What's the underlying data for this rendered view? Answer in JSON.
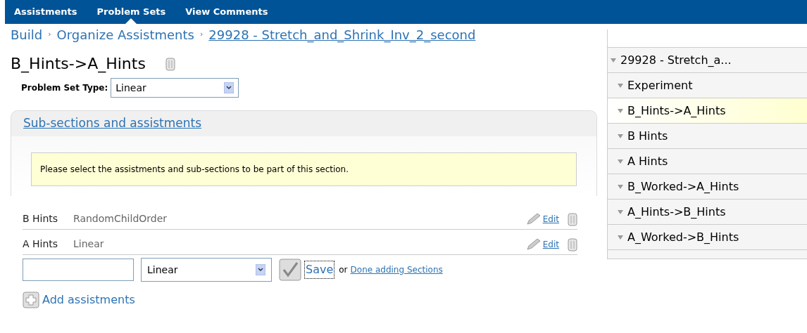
{
  "nav": {
    "tabs": [
      {
        "label": "Assistments",
        "selected": false
      },
      {
        "label": "Problem Sets",
        "selected": true
      },
      {
        "label": "View Comments",
        "selected": false
      }
    ]
  },
  "breadcrumb": {
    "items": [
      {
        "label": "Build",
        "kind": "text"
      },
      {
        "label": "Organize Assistments",
        "kind": "text"
      },
      {
        "label": "29928 - Stretch_and_Shrink_Inv_2_second",
        "kind": "link"
      }
    ],
    "separator": "›"
  },
  "title": "B_Hints->A_Hints",
  "problem_set_type": {
    "label": "Problem Set Type:",
    "value": "Linear"
  },
  "section": {
    "heading": "Sub-sections and assistments",
    "notice": "Please select the assistments and sub-sections to be part of this section.",
    "rows": [
      {
        "name": "B Hints",
        "order": "RandomChildOrder",
        "edit": "Edit"
      },
      {
        "name": "A Hints",
        "order": "Linear",
        "edit": "Edit"
      }
    ],
    "add_form": {
      "type_value": "Linear",
      "save": "Save",
      "or": "or",
      "done": "Done adding Sections"
    },
    "add_link": "Add assistments"
  },
  "tree": {
    "label": "29928 - Stretch_a...",
    "expanded": true,
    "children": [
      {
        "label": "Experiment",
        "expanded": true,
        "selected": false
      },
      {
        "label": "B_Hints->A_Hints",
        "expanded": true,
        "selected": true
      },
      {
        "label": "B Hints",
        "expanded": true,
        "selected": false
      },
      {
        "label": "A Hints",
        "expanded": true,
        "selected": false
      },
      {
        "label": "B_Worked->A_Hints",
        "expanded": true,
        "selected": false
      },
      {
        "label": "A_Hints->B_Hints",
        "expanded": true,
        "selected": false
      },
      {
        "label": "A_Worked->B_Hints",
        "expanded": true,
        "selected": false
      }
    ]
  }
}
